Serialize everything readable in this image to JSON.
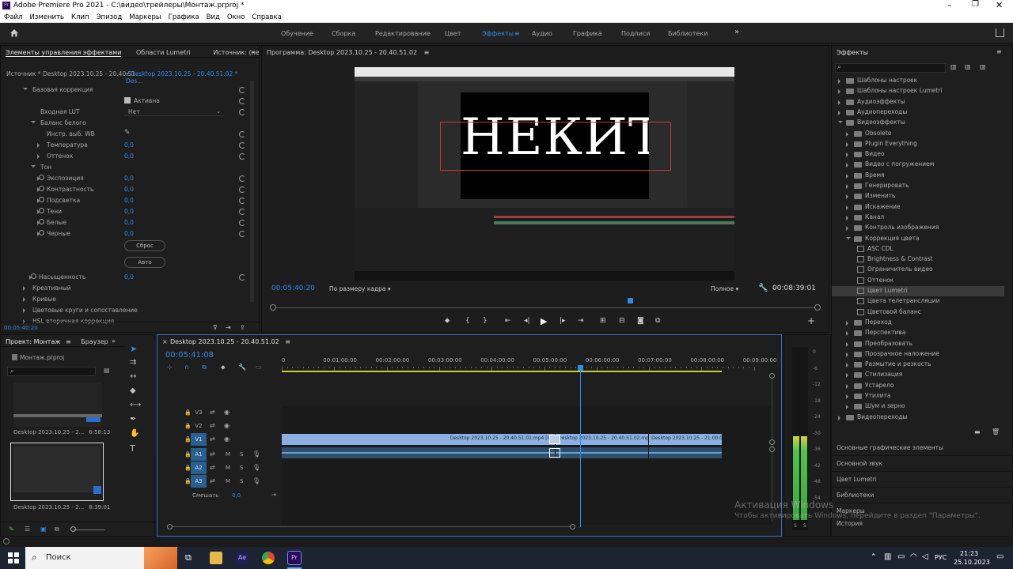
{
  "window": {
    "title": "Adobe Premiere Pro 2021 - C:\\видео\\трейлеры\\Монтаж.prproj *",
    "menu": [
      "Файл",
      "Изменить",
      "Клип",
      "Эпизод",
      "Маркеры",
      "Графика",
      "Вид",
      "Окно",
      "Справка"
    ]
  },
  "workspaces": {
    "tabs": [
      "Обучение",
      "Сборка",
      "Редактирование",
      "Цвет",
      "Эффекты",
      "Аудио",
      "Графика",
      "Подписи",
      "Библиотеки"
    ],
    "active": "Эффекты",
    "more": "»"
  },
  "effect_controls": {
    "tabs": [
      "Элементы управления эффектами",
      "Области Lumetri",
      "Источник: (нет кл"
    ],
    "source": "Источник * Desktop 2023.10.25 - 20.40.51...",
    "sequence": "Desktop 2023.10.25 - 20.40.51.02 * Des...",
    "basic": "Базовая коррекция",
    "active_label": "Активна",
    "lut_label": "Входная LUT",
    "lut_value": "Нет",
    "wb": "Баланс белого",
    "wb_picker": "Инстр. выб. WB",
    "temp": "Температура",
    "tint": "Оттенок",
    "tone": "Тон",
    "exposure": "Экспозиция",
    "contrast": "Контрастность",
    "highlights": "Подсветка",
    "shadows": "Тени",
    "whites": "Белые",
    "blacks": "Черные",
    "reset_btn": "Сброс",
    "auto_btn": "Авто",
    "saturation": "Насыщенность",
    "creative": "Креативный",
    "curves": "Кривые",
    "wheels": "Цветовые круги и сопоставление",
    "hsl_partial": "HSL вторичная коррекция",
    "zero": "0,0",
    "timecode": "00:05:40:20"
  },
  "program": {
    "title": "Программа: Desktop 2023.10.25 - 20.40.51.02",
    "timecode": "00:05:40:20",
    "fit": "По размеру кадра",
    "quality": "Полное",
    "duration": "00:08:39:01",
    "playhead": 0.655,
    "frame_text": "НЕКИТ"
  },
  "project": {
    "tabs": [
      "Проект: Монтаж",
      "Браузер"
    ],
    "file": "Монтаж.prproj",
    "items": [
      {
        "name": "Desktop 2023.10.25 - 2...",
        "dur": "6:58:13"
      },
      {
        "name": "Desktop 2023.10.25 - 2...",
        "dur": "8:39:01"
      }
    ]
  },
  "timeline": {
    "title": "Desktop 2023.10.25 - 20.40.51.02",
    "timecode": "00:05:41:08",
    "ruler": [
      "0",
      "00:01:00:00",
      "00:02:00:00",
      "00:03:00:00",
      "00:04:00:00",
      "00:05:00:00",
      "00:06:00:00",
      "00:07:00:00",
      "00:08:00:00",
      "00:09:00:00"
    ],
    "tracks_v": [
      "V3",
      "V2",
      "V1"
    ],
    "tracks_a": [
      "A1",
      "A2",
      "A3"
    ],
    "mix": "Смешать",
    "mix_val": "0,0",
    "clips": [
      {
        "label": "Desktop 2023.10.25 - 20.40.51.01.mp4 [V]",
        "start": 0,
        "end": 5.22
      },
      {
        "label": "Desktop 2023.10.25 - 20.40.51.02.mp4 [V]",
        "start": 5.22,
        "end": 7.0
      },
      {
        "label": "Desktop 2023.10.25 - 21.00.00.05.m",
        "start": 7.0,
        "end": 8.4
      }
    ],
    "playhead_min": 5.69
  },
  "effects": {
    "title": "Эффекты",
    "tree": [
      {
        "l": 0,
        "t": "folder",
        "n": "Шаблоны настроек"
      },
      {
        "l": 0,
        "t": "folder",
        "n": "Шаблоны настроек Lumetri"
      },
      {
        "l": 0,
        "t": "folder",
        "n": "Аудиоэффекты"
      },
      {
        "l": 0,
        "t": "folder",
        "n": "Аудиопереходы"
      },
      {
        "l": 0,
        "t": "folder",
        "n": "Видеоэффекты",
        "open": true
      },
      {
        "l": 1,
        "t": "folder",
        "n": "Obsolete"
      },
      {
        "l": 1,
        "t": "folder",
        "n": "Plugin Everything"
      },
      {
        "l": 1,
        "t": "folder",
        "n": "Видео"
      },
      {
        "l": 1,
        "t": "folder",
        "n": "Видео с погружением"
      },
      {
        "l": 1,
        "t": "folder",
        "n": "Время"
      },
      {
        "l": 1,
        "t": "folder",
        "n": "Генерировать"
      },
      {
        "l": 1,
        "t": "folder",
        "n": "Изменить"
      },
      {
        "l": 1,
        "t": "folder",
        "n": "Искажение"
      },
      {
        "l": 1,
        "t": "folder",
        "n": "Канал"
      },
      {
        "l": 1,
        "t": "folder",
        "n": "Контроль изображения"
      },
      {
        "l": 1,
        "t": "folder",
        "n": "Коррекция цвета",
        "open": true
      },
      {
        "l": 2,
        "t": "fx",
        "n": "ASC CDL"
      },
      {
        "l": 2,
        "t": "fx",
        "n": "Brightness & Contrast"
      },
      {
        "l": 2,
        "t": "fx",
        "n": "Ограничитель видео"
      },
      {
        "l": 2,
        "t": "fx",
        "n": "Оттенок"
      },
      {
        "l": 2,
        "t": "fx",
        "n": "Цвет Lumetri",
        "sel": true
      },
      {
        "l": 2,
        "t": "fx",
        "n": "Цвета телетрансляции"
      },
      {
        "l": 2,
        "t": "fx",
        "n": "Цветовой баланс"
      },
      {
        "l": 1,
        "t": "folder",
        "n": "Переход"
      },
      {
        "l": 1,
        "t": "folder",
        "n": "Перспектива"
      },
      {
        "l": 1,
        "t": "folder",
        "n": "Преобразовать"
      },
      {
        "l": 1,
        "t": "folder",
        "n": "Прозрачное наложение"
      },
      {
        "l": 1,
        "t": "folder",
        "n": "Размытие и резкость"
      },
      {
        "l": 1,
        "t": "folder",
        "n": "Стилизация"
      },
      {
        "l": 1,
        "t": "folder",
        "n": "Устарело"
      },
      {
        "l": 1,
        "t": "folder",
        "n": "Утилита"
      },
      {
        "l": 1,
        "t": "folder",
        "n": "Шум и зерно"
      },
      {
        "l": 0,
        "t": "folder",
        "n": "Видеопереходы"
      }
    ],
    "panels": [
      "Основные графические элементы",
      "Основной звук",
      "Цвет Lumetri",
      "Библиотеки",
      "Маркеры",
      "История"
    ]
  },
  "meter": {
    "ticks": [
      "0",
      "-6",
      "-12",
      "-18",
      "-24",
      "-30",
      "-36",
      "-42",
      "-48",
      "-54"
    ],
    "solo": [
      "S",
      "S"
    ]
  },
  "watermark": {
    "line1": "Активация Windows",
    "line2": "Чтобы активировать Windows, перейдите в раздел \"Параметры\"."
  },
  "taskbar": {
    "search": "Поиск",
    "lang": "РУС",
    "time": "21:23",
    "date": "25.10.2023"
  }
}
